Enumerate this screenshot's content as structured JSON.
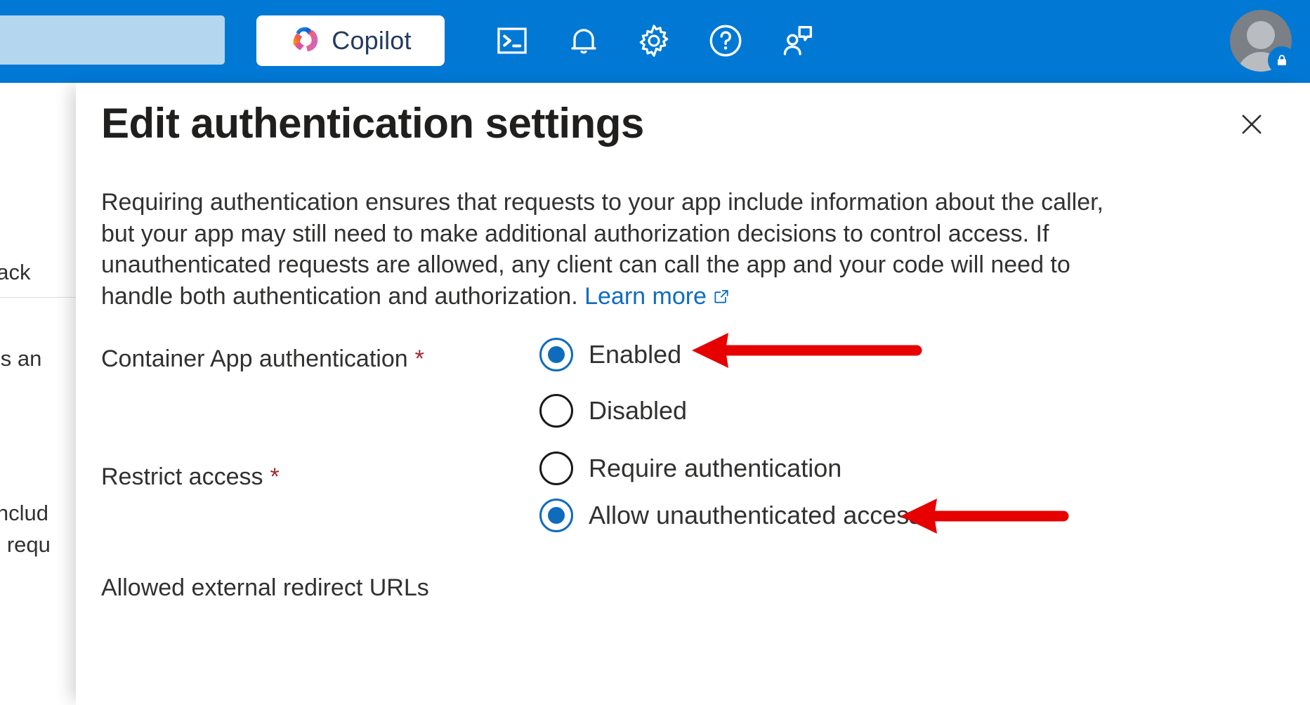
{
  "topbar": {
    "bg_color": "#0078d4",
    "search_placeholder": "",
    "copilot_label": "Copilot",
    "icons": [
      {
        "name": "cloud-shell-icon",
        "title": "Cloud Shell"
      },
      {
        "name": "notifications-bell-icon",
        "title": "Notifications"
      },
      {
        "name": "settings-gear-icon",
        "title": "Settings"
      },
      {
        "name": "help-question-icon",
        "title": "Help"
      },
      {
        "name": "feedback-person-icon",
        "title": "Feedback"
      }
    ],
    "avatar": {
      "name": "account-avatar",
      "badge": "lock-badge"
    }
  },
  "background": {
    "fragments": [
      "back",
      "ties an",
      "includ",
      "d requ"
    ]
  },
  "panel": {
    "title": "Edit authentication settings",
    "close_label": "✕",
    "description_part1": "Requiring authentication ensures that requests to your app include information about the caller, but your app may still need to make additional authorization decisions to control access. If unauthenticated requests are allowed, any client can call the app and your code will need to handle both authentication and authorization. ",
    "learn_more": "Learn more",
    "fields": [
      {
        "label": "Container App authentication",
        "required_marker": "*",
        "options": [
          {
            "label": "Enabled",
            "checked": true
          },
          {
            "label": "Disabled",
            "checked": false
          }
        ]
      },
      {
        "label": "Restrict access",
        "required_marker": "*",
        "options": [
          {
            "label": "Require authentication",
            "checked": false
          },
          {
            "label": "Allow unauthenticated access",
            "checked": true
          }
        ]
      }
    ],
    "next_field_label": "Allowed external redirect URLs"
  },
  "annotations": {
    "color": "#e60000",
    "arrows": [
      {
        "name": "arrow-to-enabled",
        "points_to": "Enabled"
      },
      {
        "name": "arrow-to-allow-unauthenticated",
        "points_to": "Allow unauthenticated access"
      }
    ]
  }
}
